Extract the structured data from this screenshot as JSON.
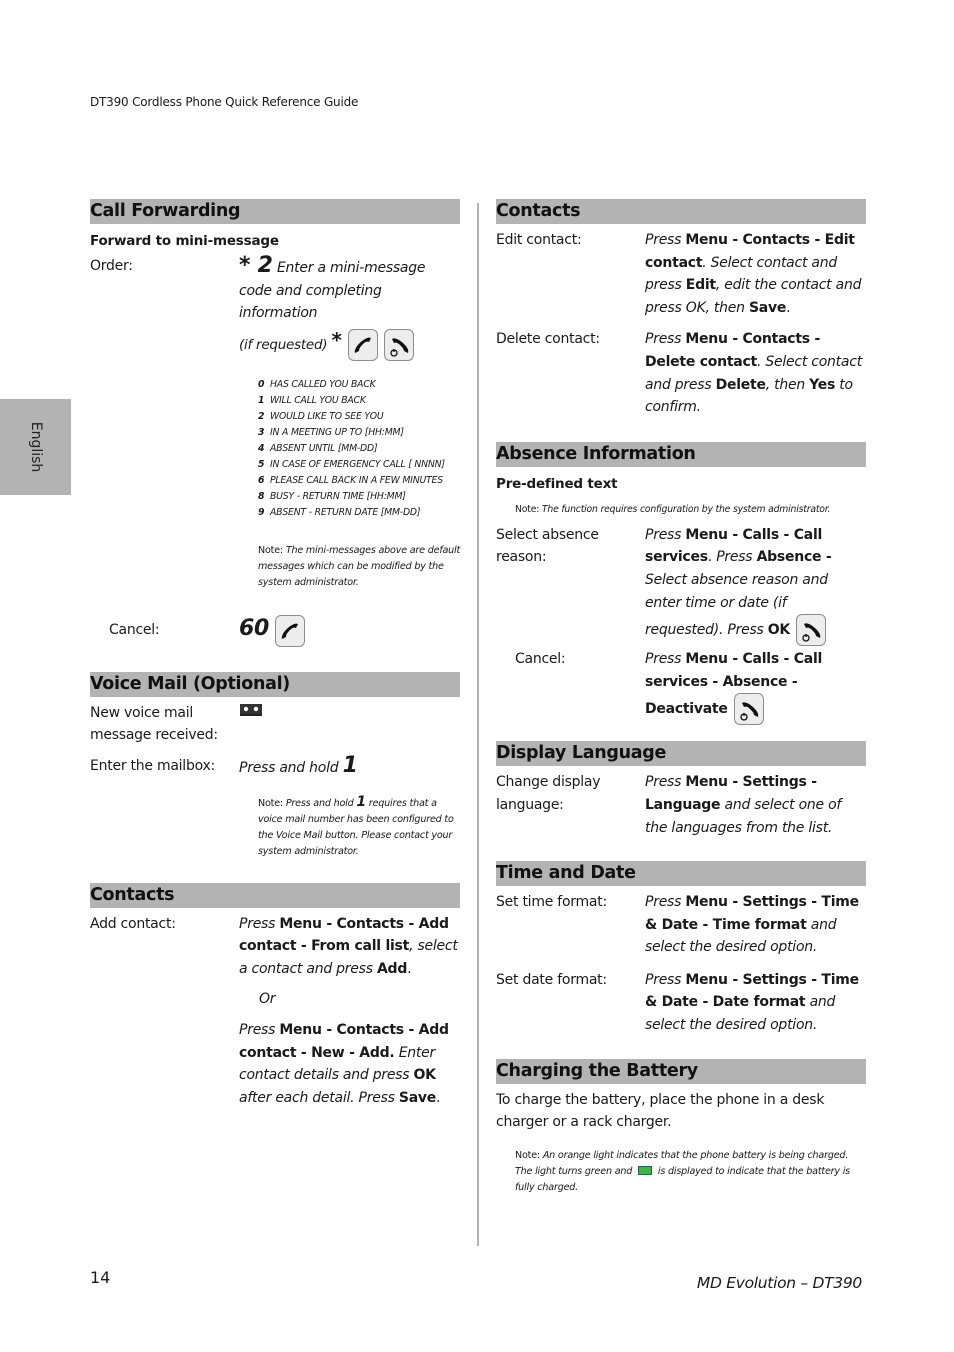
{
  "header": {
    "title": "DT390 Cordless Phone Quick Reference Guide"
  },
  "side_tab": {
    "label": "English"
  },
  "footer": {
    "page_number": "14",
    "product": "MD Evolution – DT390"
  },
  "left": {
    "call_forwarding": {
      "title": "Call Forwarding",
      "subtitle": "Forward to mini-message",
      "order_label": "Order:",
      "order_key": "* 2",
      "order_text_1": "Enter a mini-message code and completing information",
      "order_text_2": "(if requested)",
      "order_star": "*",
      "icons": [
        "call-key-icon",
        "end-call-key-icon"
      ],
      "messages": [
        {
          "code": "0",
          "text": "HAS CALLED YOU BACK"
        },
        {
          "code": "1",
          "text": "WILL CALL YOU BACK"
        },
        {
          "code": "2",
          "text": "WOULD LIKE TO SEE YOU"
        },
        {
          "code": "3",
          "text": "IN A MEETING UP TO [HH:MM]"
        },
        {
          "code": "4",
          "text": "ABSENT UNTIL [MM-DD]"
        },
        {
          "code": "5",
          "text": "IN CASE OF EMERGENCY CALL [ NNNN]"
        },
        {
          "code": "6",
          "text": "PLEASE CALL BACK IN A FEW MINUTES"
        },
        {
          "code": "8",
          "text": "BUSY - RETURN TIME [HH:MM]"
        },
        {
          "code": "9",
          "text": "ABSENT - RETURN DATE [MM-DD]"
        }
      ],
      "note_prefix": "Note:",
      "note_text": "The mini-messages above are default messages which can be modified by the system administrator.",
      "cancel_label": "Cancel:",
      "cancel_key": "60"
    },
    "voice_mail": {
      "title": "Voice Mail (Optional)",
      "new_label": "New voice mail message received:",
      "enter_label": "Enter the mailbox:",
      "enter_text": "Press and hold",
      "enter_key": "1",
      "note_prefix": "Note:",
      "note_pre": "Press and hold",
      "note_key": "1",
      "note_post": "requires that a voice mail number has been configured to the Voice Mail button. Please contact your system administrator."
    },
    "contacts": {
      "title": "Contacts",
      "add_label": "Add contact:",
      "add_1": {
        "press": "Press",
        "path": "Menu - Contacts - Add contact - From call list",
        "mid": ", select a contact and press",
        "btn": "Add",
        "end": "."
      },
      "or": "Or",
      "add_2": {
        "press": "Press",
        "path": "Menu - Contacts - Add contact - New - Add.",
        "mid": "Enter contact details and press",
        "ok": "OK",
        "mid2": "after each detail. Press",
        "save": "Save",
        "end": "."
      }
    }
  },
  "right": {
    "contacts": {
      "title": "Contacts",
      "edit_label": "Edit contact:",
      "edit": {
        "press": "Press",
        "path": "Menu - Contacts - Edit contact",
        "t1": ". Select contact and press",
        "edit": "Edit",
        "t2": ", edit the contact and press OK, then",
        "save": "Save",
        "end": "."
      },
      "delete_label": "Delete contact:",
      "delete": {
        "press": "Press",
        "path": "Menu - Contacts - Delete contact",
        "t1": ". Select contact and press",
        "del": "Delete",
        "t2": ", then",
        "yes": "Yes",
        "t3": "to confirm."
      }
    },
    "absence": {
      "title": "Absence Information",
      "subtitle": "Pre-defined text",
      "note_prefix": "Note:",
      "note_text": "The function requires configuration by the system administrator.",
      "select_label": "Select absence reason:",
      "select": {
        "press": "Press",
        "path": "Menu - Calls - Call services",
        "dot": ".",
        "press2": "Press",
        "absence": "Absence -",
        "t1": "Select absence reason and enter time or date (if requested). Press",
        "ok": "OK"
      },
      "cancel_label": "Cancel:",
      "cancel": {
        "press": "Press",
        "path": "Menu - Calls - Call services - Absence - Deactivate"
      }
    },
    "display_language": {
      "title": "Display Language",
      "label": "Change display language:",
      "press": "Press",
      "path": "Menu - Settings - Language",
      "t1": "and select one of the languages from the list."
    },
    "time_date": {
      "title": "Time and Date",
      "time_label": "Set time format:",
      "time": {
        "press": "Press",
        "path": "Menu - Settings - Time & Date - Time format",
        "t1": "and select the desired option."
      },
      "date_label": "Set date format:",
      "date": {
        "press": "Press",
        "path": "Menu - Settings - Time & Date - Date format",
        "t1": "and select the desired option."
      }
    },
    "battery": {
      "title": "Charging the Battery",
      "text": "To charge the battery, place the phone in a desk charger or a rack charger.",
      "note_prefix": "Note:",
      "note_1": "An orange light indicates that the phone battery is being charged. The light turns green and",
      "note_2": "is displayed to indicate that the battery is fully charged."
    }
  }
}
